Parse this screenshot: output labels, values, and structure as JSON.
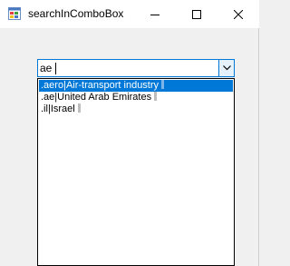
{
  "window": {
    "title": "searchInComboBox",
    "controls": [
      "minimize-icon",
      "maximize-icon",
      "close-icon"
    ]
  },
  "combo": {
    "value": "ae",
    "button_icon": "chevron-down-icon",
    "options": [
      {
        "code": ".aero",
        "name": "Air-transport industry",
        "selected": true
      },
      {
        "code": ".ae",
        "name": "United Arab Emirates",
        "selected": false
      },
      {
        "code": ".il",
        "name": "Israel",
        "selected": false
      }
    ]
  },
  "colors": {
    "accent": "#0078d7",
    "selection_text": "#ffffff"
  }
}
